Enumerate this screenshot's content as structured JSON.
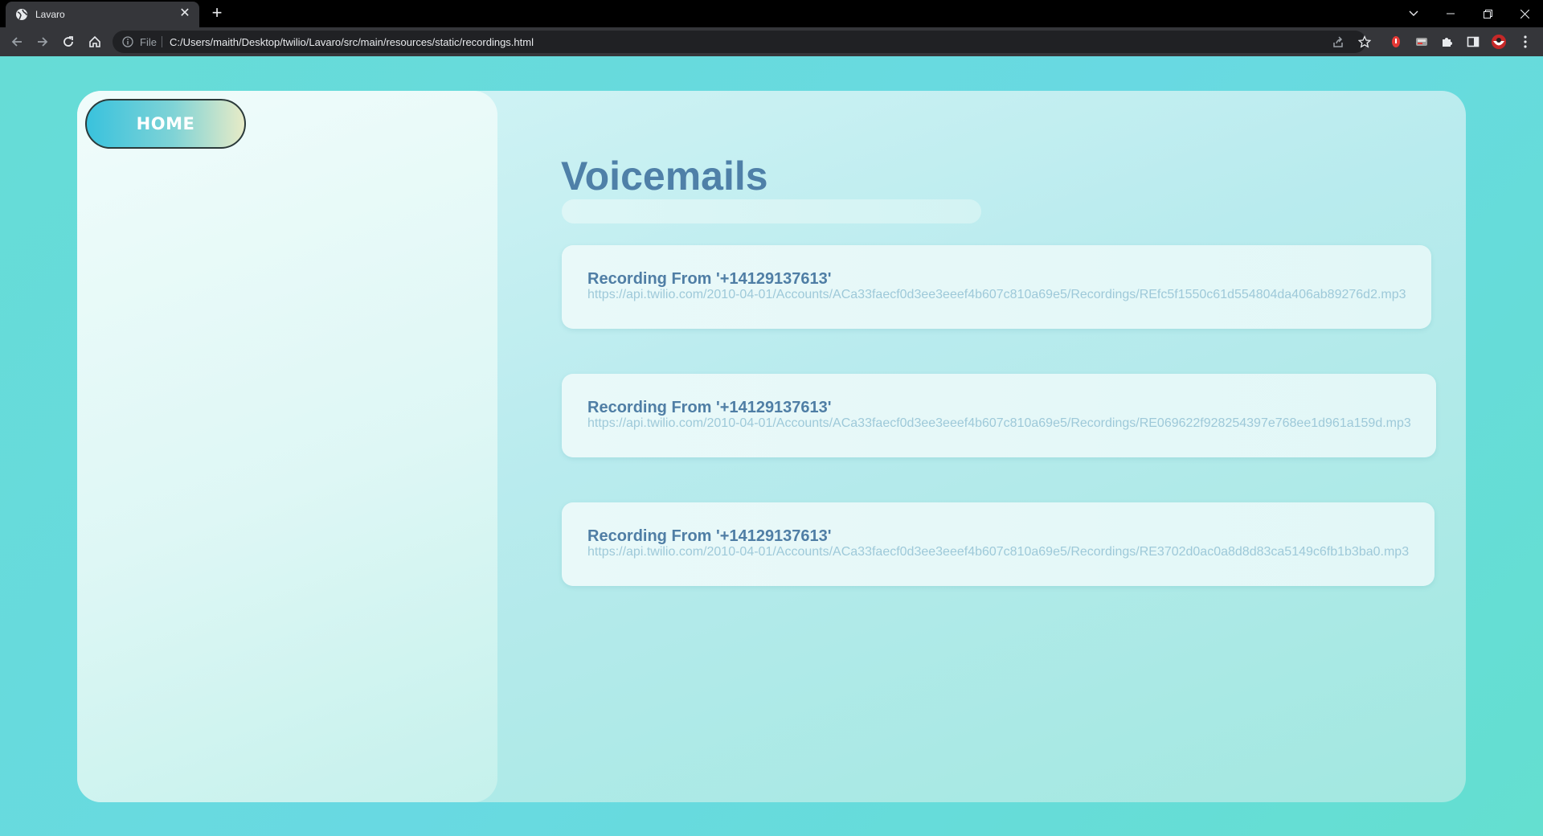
{
  "browser": {
    "tab_title": "Lavaro",
    "scheme_label": "File",
    "url": "C:/Users/maith/Desktop/twilio/Lavaro/src/main/resources/static/recordings.html"
  },
  "sidebar": {
    "home_label": "HOME"
  },
  "main": {
    "title": "Voicemails",
    "recordings": [
      {
        "title": "Recording From '+14129137613'",
        "url": "https://api.twilio.com/2010-04-01/Accounts/ACa33faecf0d3ee3eeef4b607c810a69e5/Recordings/REfc5f1550c61d554804da406ab89276d2.mp3"
      },
      {
        "title": "Recording From '+14129137613'",
        "url": "https://api.twilio.com/2010-04-01/Accounts/ACa33faecf0d3ee3eeef4b607c810a69e5/Recordings/RE069622f928254397e768ee1d961a159d.mp3"
      },
      {
        "title": "Recording From '+14129137613'",
        "url": "https://api.twilio.com/2010-04-01/Accounts/ACa33faecf0d3ee3eeef4b607c810a69e5/Recordings/RE3702d0ac0a8d8d83ca5149c6fb1b3ba0.mp3"
      }
    ]
  },
  "colors": {
    "page_bg": "#66dcd6",
    "title": "#4f80a8",
    "recording_title": "#4f7ea5",
    "recording_url": "#9ec9d9"
  }
}
